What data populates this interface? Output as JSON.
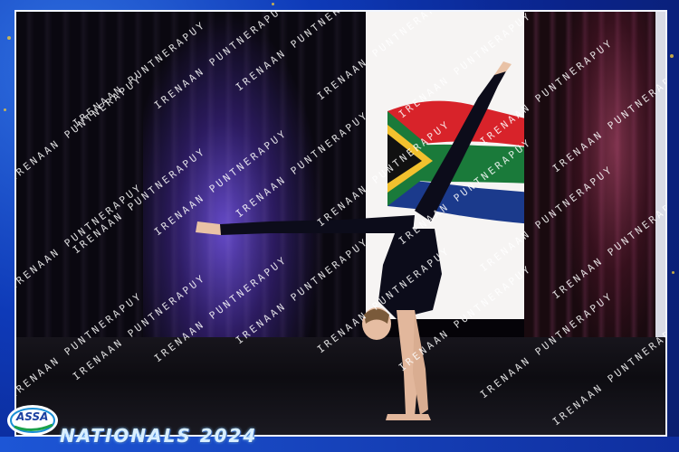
{
  "event": {
    "title": "NATIONALS 2024",
    "logo_text": "ASSA"
  },
  "watermark": {
    "text": "IRENAAN PUNTNERAPUY",
    "color": "#ffffff"
  },
  "colors": {
    "frame_blue": "#0e3ab8",
    "stage_purple": "#6e50e6",
    "flag_red": "#d8232a",
    "flag_green": "#1a7a3a",
    "flag_blue": "#1b3a8c",
    "flag_yellow": "#f2c12e"
  }
}
